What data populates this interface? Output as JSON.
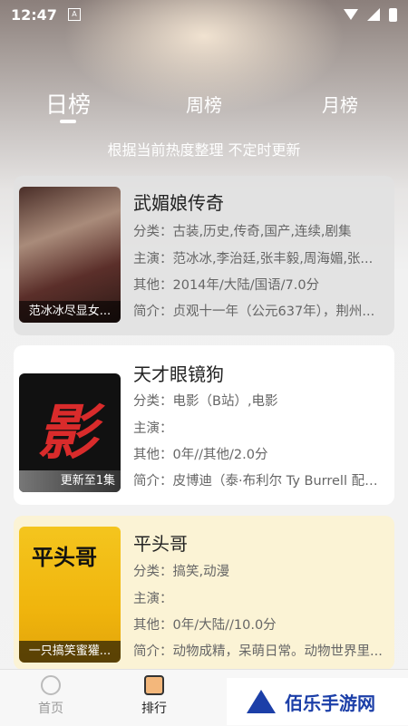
{
  "status": {
    "time": "12:47",
    "notif_icon": "A"
  },
  "tabs": [
    {
      "label": "日榜",
      "active": true
    },
    {
      "label": "周榜",
      "active": false
    },
    {
      "label": "月榜",
      "active": false
    }
  ],
  "subtitle": "根据当前热度整理 不定时更新",
  "items": [
    {
      "title": "武媚娘传奇",
      "category": "分类：古装,历史,传奇,国产,连续,剧集",
      "cast": "主演：范冰冰,李治廷,张丰毅,周海媚,张...",
      "other": "其他：2014年/大陆/国语/7.0分",
      "intro": "简介：贞观十一年（公元637年），荆州...",
      "poster_caption": "范冰冰尽显女..."
    },
    {
      "title": "天才眼镜狗",
      "category": "分类：电影（B站）,电影",
      "cast": "主演：",
      "other": "其他：0年//其他/2.0分",
      "intro": "简介：皮博迪（泰·布利尔 Ty Burrell 配音...",
      "poster_caption": "更新至1集",
      "poster_art": "影"
    },
    {
      "title": "平头哥",
      "category": "分类：搞笑,动漫",
      "cast": "主演：",
      "other": "其他：0年/大陆//10.0分",
      "intro": "简介：动物成精，呆萌日常。动物世界里...",
      "poster_caption": "一只搞笑蜜獾...",
      "poster_art": "平头哥"
    }
  ],
  "nav": {
    "home": "首页",
    "rank": "排行"
  },
  "watermark": "佰乐手游网",
  "colors": {
    "watermark_blue": "#1c3fa8",
    "card3_bg": "#fbf3d5"
  }
}
